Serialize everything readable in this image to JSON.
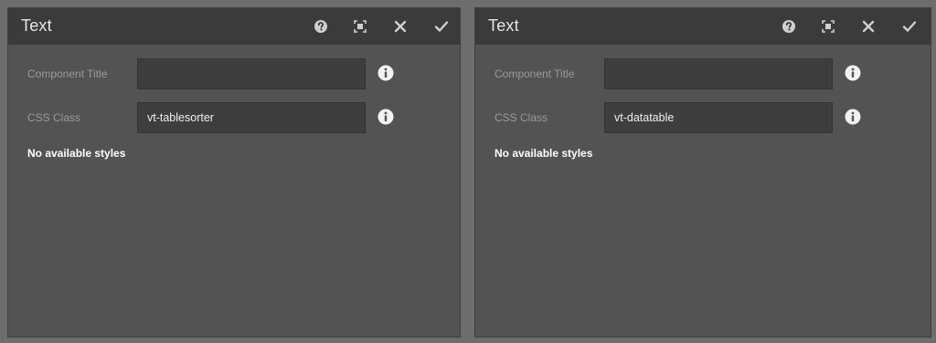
{
  "dialogs": [
    {
      "title": "Text",
      "fields": [
        {
          "label": "Component Title",
          "value": ""
        },
        {
          "label": "CSS Class",
          "value": "vt-tablesorter"
        }
      ],
      "styles_message": "No available styles"
    },
    {
      "title": "Text",
      "fields": [
        {
          "label": "Component Title",
          "value": ""
        },
        {
          "label": "CSS Class",
          "value": "vt-datatable"
        }
      ],
      "styles_message": "No available styles"
    }
  ],
  "icons": {
    "help": "help-icon",
    "fullscreen": "fullscreen-icon",
    "close": "close-icon",
    "confirm": "checkmark-icon",
    "info": "info-icon"
  },
  "colors": {
    "page_background": "#6d6d6d",
    "panel_background": "#535353",
    "header_background": "#3b3b3b",
    "input_background": "#3e3e3e",
    "label_text": "#9a9a9a",
    "icon_color": "#d0d0d0"
  }
}
